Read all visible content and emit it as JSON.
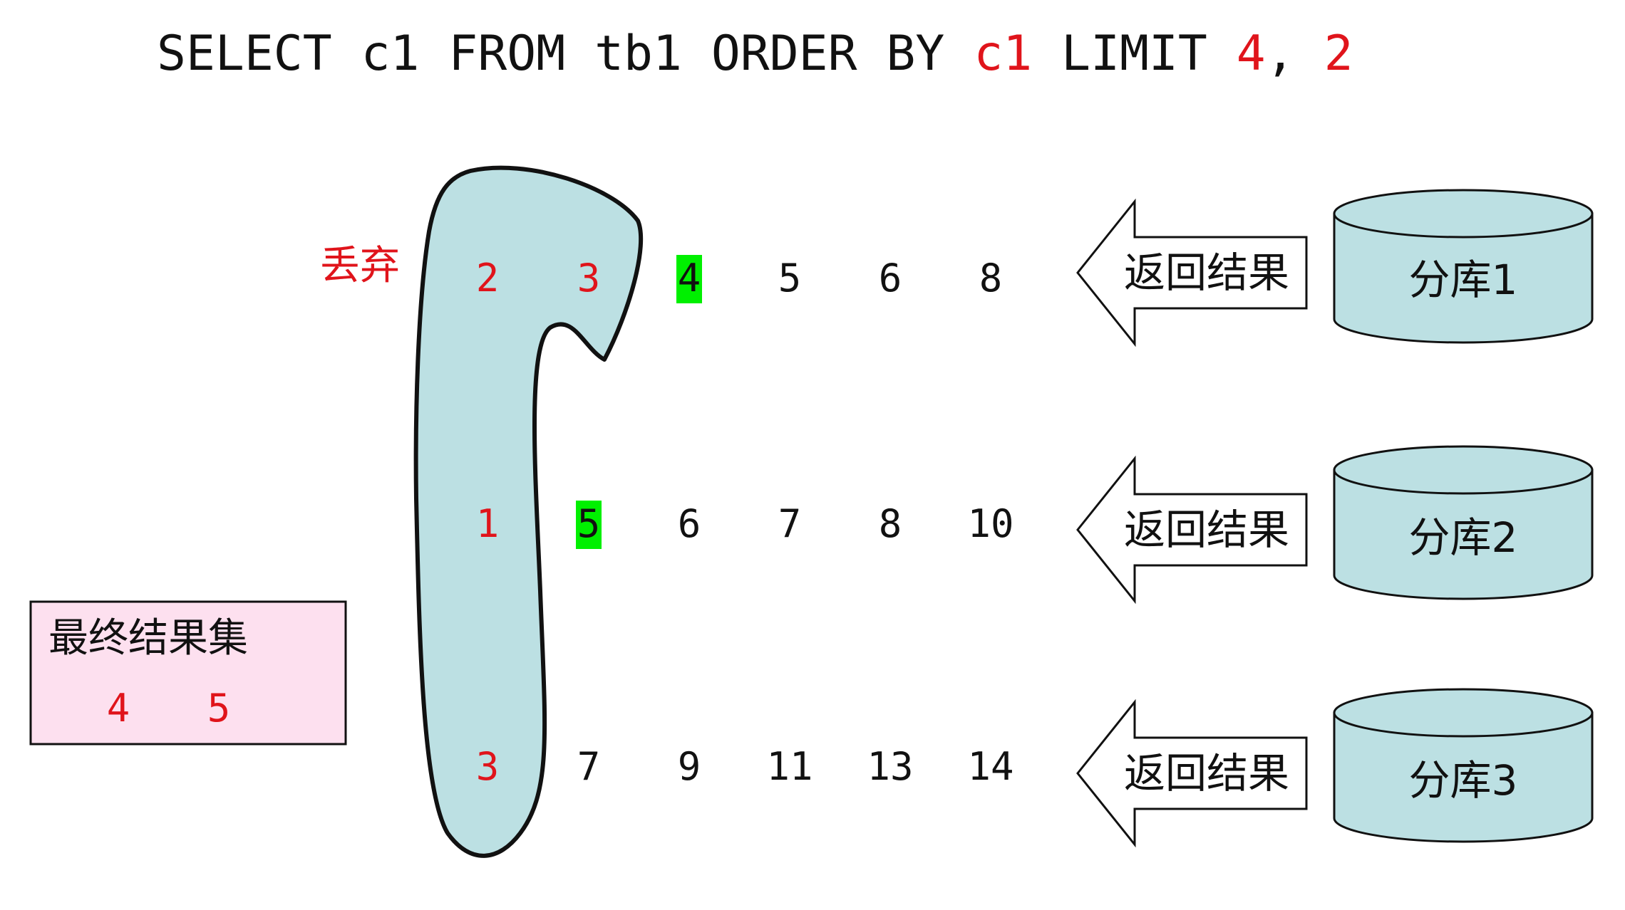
{
  "colors": {
    "black": "#111111",
    "red": "#e0141b",
    "highlight": "#00f000",
    "blob_fill": "#bce0e3",
    "cylinder_fill": "#bce0e3",
    "result_box_fill": "#fde0ef"
  },
  "query": {
    "part1": "SELECT c1 FROM tb1 ORDER BY ",
    "order_col": "c1",
    "part2": " LIMIT ",
    "offset": "4",
    "comma": ", ",
    "count": "2"
  },
  "discard_label": "丢弃",
  "rows": [
    {
      "shard": "分库1",
      "arrow_label": "返回结果",
      "values": [
        {
          "text": "2",
          "state": "discarded"
        },
        {
          "text": "3",
          "state": "discarded"
        },
        {
          "text": "4",
          "state": "selected"
        },
        {
          "text": "5",
          "state": "normal"
        },
        {
          "text": "6",
          "state": "normal"
        },
        {
          "text": "8",
          "state": "normal"
        }
      ]
    },
    {
      "shard": "分库2",
      "arrow_label": "返回结果",
      "values": [
        {
          "text": "1",
          "state": "discarded"
        },
        {
          "text": "5",
          "state": "selected"
        },
        {
          "text": "6",
          "state": "normal"
        },
        {
          "text": "7",
          "state": "normal"
        },
        {
          "text": "8",
          "state": "normal"
        },
        {
          "text": "10",
          "state": "normal"
        }
      ]
    },
    {
      "shard": "分库3",
      "arrow_label": "返回结果",
      "values": [
        {
          "text": "3",
          "state": "discarded"
        },
        {
          "text": "7",
          "state": "normal"
        },
        {
          "text": "9",
          "state": "normal"
        },
        {
          "text": "11",
          "state": "normal"
        },
        {
          "text": "13",
          "state": "normal"
        },
        {
          "text": "14",
          "state": "normal"
        }
      ]
    }
  ],
  "final_result": {
    "title": "最终结果集",
    "values": [
      "4",
      "5"
    ]
  }
}
